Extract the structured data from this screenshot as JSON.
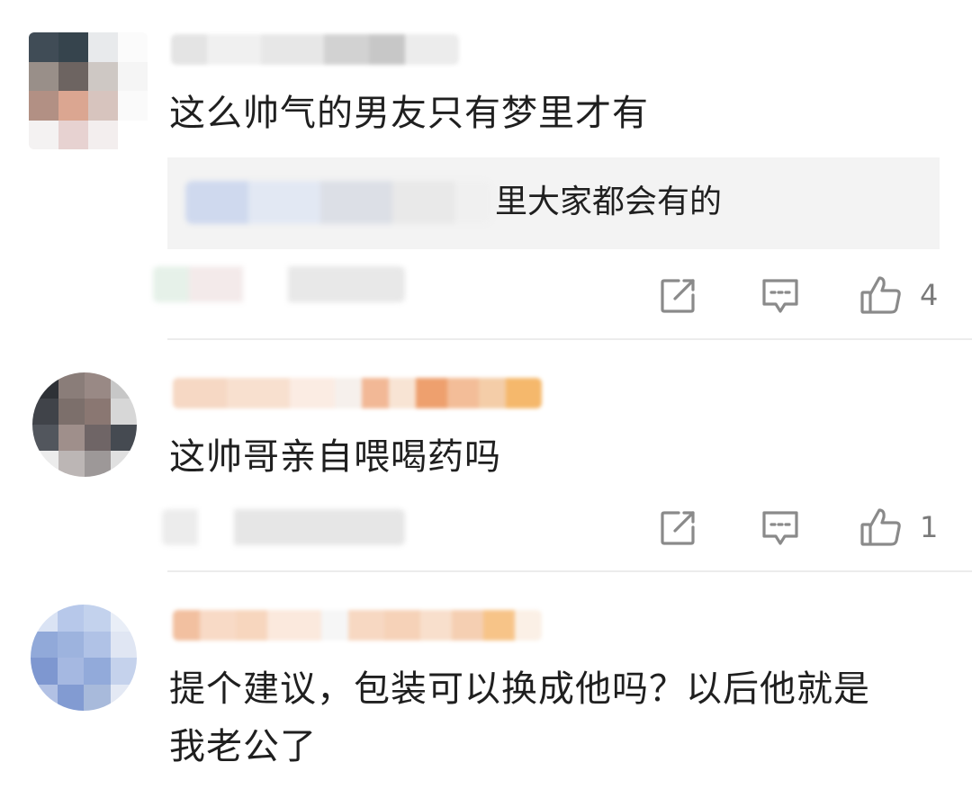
{
  "comments": [
    {
      "text": "这么帅气的男友只有梦里才有",
      "reply": {
        "text": "里大家都会有的"
      },
      "actions": {
        "share_icon": "share-icon",
        "reply_icon": "comment-icon",
        "like_icon": "thumbs-up-icon",
        "like_count": "4"
      }
    },
    {
      "text": "这帅哥亲自喂喝药吗",
      "actions": {
        "share_icon": "share-icon",
        "reply_icon": "comment-icon",
        "like_icon": "thumbs-up-icon",
        "like_count": "1"
      }
    },
    {
      "text_line1": "提个建议，包装可以换成他吗？以后他就是",
      "text_line2": "我老公了"
    }
  ],
  "colors": {
    "background": "#ffffff",
    "quote_background": "#f3f3f3",
    "icon_gray": "#8a8a8a",
    "text": "#1f1f1f"
  }
}
